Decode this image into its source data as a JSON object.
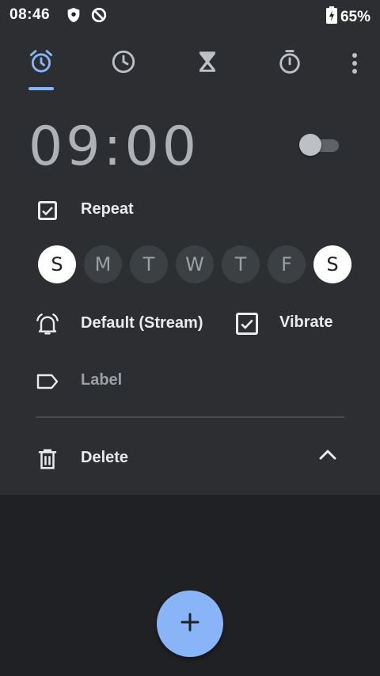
{
  "status_bar": {
    "time": "08:46",
    "icons": [
      "shield-icon",
      "data-saver-icon"
    ],
    "battery_icon": "battery-charging-icon",
    "battery_percent": "65%"
  },
  "tabs": [
    {
      "name": "alarm",
      "icon": "alarm-icon",
      "selected": true
    },
    {
      "name": "clock",
      "icon": "clock-icon",
      "selected": false
    },
    {
      "name": "timer",
      "icon": "hourglass-icon",
      "selected": false
    },
    {
      "name": "stopwatch",
      "icon": "stopwatch-icon",
      "selected": false
    }
  ],
  "overflow_icon": "more-vert-icon",
  "alarm": {
    "time": "09:00",
    "enabled": false,
    "repeat_label": "Repeat",
    "repeat_checked": true,
    "days": [
      {
        "letter": "S",
        "selected": true
      },
      {
        "letter": "M",
        "selected": false
      },
      {
        "letter": "T",
        "selected": false
      },
      {
        "letter": "W",
        "selected": false
      },
      {
        "letter": "T",
        "selected": false
      },
      {
        "letter": "F",
        "selected": false
      },
      {
        "letter": "S",
        "selected": true
      }
    ],
    "ringtone_label": "Default (Stream)",
    "ringtone_icon": "alarm-bell-icon",
    "vibrate_label": "Vibrate",
    "vibrate_checked": true,
    "label_placeholder": "Label",
    "label_icon": "label-tag-icon",
    "delete_label": "Delete",
    "delete_icon": "trash-icon",
    "collapse_icon": "chevron-up-icon"
  },
  "fab": {
    "icon": "plus-icon"
  },
  "colors": {
    "background": "#202124",
    "card": "#2d2e31",
    "accent": "#8ab4f8",
    "text": "#e8eaed",
    "muted_text": "#9aa0a6"
  }
}
